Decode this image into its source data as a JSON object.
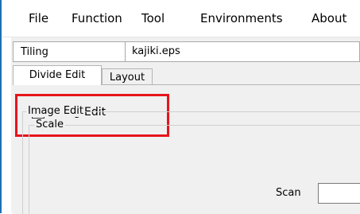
{
  "menu": {
    "items": [
      "File",
      "Function",
      "Tool",
      "Environments",
      "About"
    ]
  },
  "header": {
    "label": "Tiling",
    "filename": "kajiki.eps"
  },
  "tabs": [
    {
      "label": "Divide Edit",
      "active": true
    },
    {
      "label": "Layout",
      "active": false
    }
  ],
  "panel": {
    "tiling_edit": {
      "label": "Tiling Edit",
      "checked": true
    },
    "image_edit_group": {
      "title": "Image Edit"
    },
    "scale_group": {
      "title": "Scale"
    },
    "scan": {
      "label": "Scan",
      "value": ""
    }
  },
  "colors": {
    "highlight": "#e8141b",
    "accent_stripe": "#1f6fb2",
    "panel_bg": "#f0f0f0"
  }
}
